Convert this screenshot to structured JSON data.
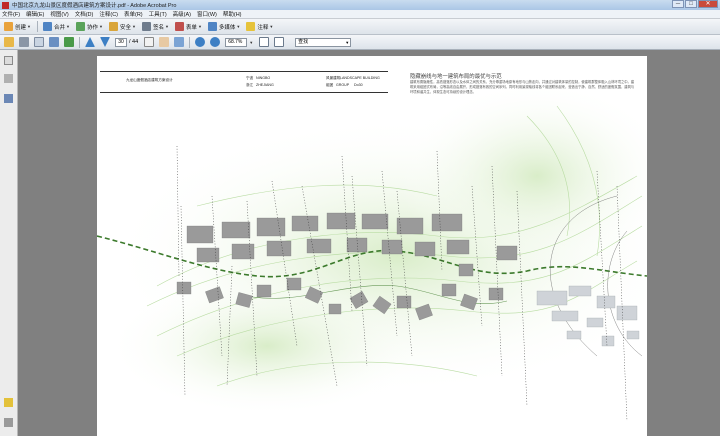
{
  "window": {
    "title": "中国北京九龙山景区度假酒店建筑方案设计.pdf - Adobe Acrobat Pro",
    "minimize": "─",
    "maximize": "□",
    "close": "✕"
  },
  "menu": [
    "文件(F)",
    "编辑(E)",
    "视图(V)",
    "文档(D)",
    "注释(C)",
    "表单(R)",
    "工具(T)",
    "高级(A)",
    "窗口(W)",
    "帮助(H)"
  ],
  "toolbar1": {
    "items": [
      {
        "label": "创建",
        "icon": "create-icon",
        "color": "#e9a23b"
      },
      {
        "label": "合并",
        "icon": "combine-icon",
        "color": "#4f84c4"
      },
      {
        "label": "协作",
        "icon": "collaborate-icon",
        "color": "#5aa35a"
      },
      {
        "label": "安全",
        "icon": "lock-icon",
        "color": "#d9a53a"
      },
      {
        "label": "签名",
        "icon": "pen-icon",
        "color": "#6f7c8c"
      },
      {
        "label": "表单",
        "icon": "form-icon",
        "color": "#c0504d"
      },
      {
        "label": "多媒体",
        "icon": "multimedia-icon",
        "color": "#4f84c4"
      },
      {
        "label": "注释",
        "icon": "comment-icon",
        "color": "#e6c33b"
      }
    ]
  },
  "toolbar2": {
    "page_current": "30",
    "page_total": "/ 44",
    "zoom": "68.7%",
    "search_placeholder": "查找"
  },
  "document": {
    "titleblock": {
      "project": "九龙山度假酒店建筑方案设计",
      "city_label": "宁波",
      "city_en": "NINGBO",
      "region_label": "浙江",
      "region_en": "ZHEJIANG",
      "type_label": "风景建筑",
      "type_en": "LANDSCAPE BUILDING",
      "group_label": "组团",
      "group_en": "GROUP",
      "sheet": "Do30"
    },
    "heading": "隐藏崩线与地一建筑布局的最优与示范",
    "body": "建筑布置隐蔽性，高低错落形态以及水体之间的关系，充分尊重场地原有地形与山势走向，并通过对建筑体量的控制，使建筑群整体融入山林环境之中。建筑采用组团式布局，沿等高线自由展开，形成错落有致的空间序列。同时利用景观轴线将各个组团联系起来，营造出宁静、自然、舒适的度假氛围，建筑与环境和谐共生，体现生态可持续的设计理念。"
  },
  "colors": {
    "accent": "#3c7a2c",
    "building": "#9a9a9a",
    "contour": "#a8d08d"
  }
}
